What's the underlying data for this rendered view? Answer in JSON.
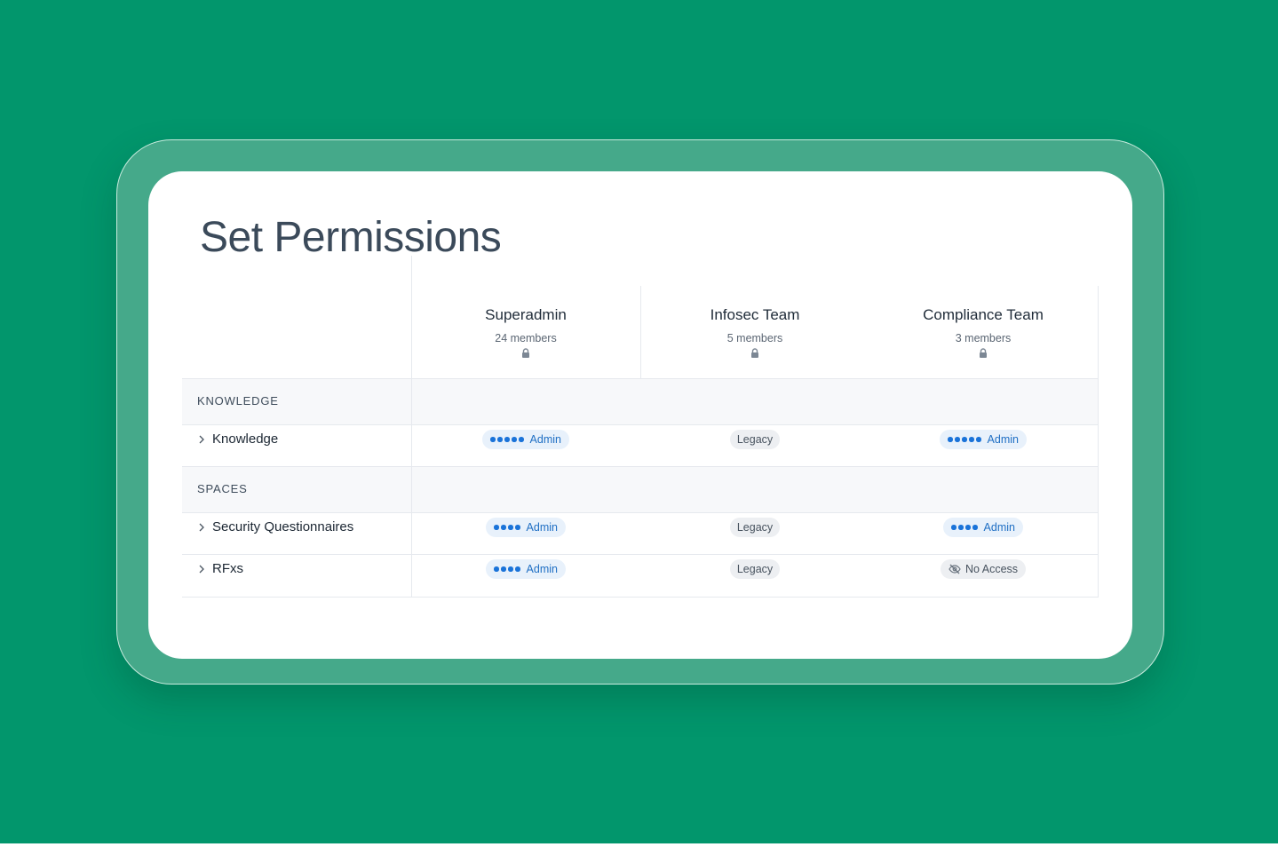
{
  "page": {
    "title": "Set Permissions"
  },
  "columns": [
    {
      "name": "Superadmin",
      "members": "24 members",
      "icon": "lock-icon"
    },
    {
      "name": "Infosec Team",
      "members": "5 members",
      "icon": "lock-icon"
    },
    {
      "name": "Compliance Team",
      "members": "3 members",
      "icon": "lock-icon"
    }
  ],
  "sections": [
    {
      "label": "KNOWLEDGE",
      "rows": [
        {
          "label": "Knowledge",
          "cells": [
            {
              "type": "admin",
              "level": 5,
              "text": "Admin"
            },
            {
              "type": "legacy",
              "text": "Legacy"
            },
            {
              "type": "admin",
              "level": 5,
              "text": "Admin"
            }
          ]
        }
      ]
    },
    {
      "label": "SPACES",
      "rows": [
        {
          "label": "Security Questionnaires",
          "cells": [
            {
              "type": "admin",
              "level": 4,
              "text": "Admin"
            },
            {
              "type": "legacy",
              "text": "Legacy"
            },
            {
              "type": "admin",
              "level": 4,
              "text": "Admin"
            }
          ]
        },
        {
          "label": "RFxs",
          "cells": [
            {
              "type": "admin",
              "level": 4,
              "text": "Admin"
            },
            {
              "type": "legacy",
              "text": "Legacy"
            },
            {
              "type": "noaccess",
              "text": "No Access",
              "icon": "eye-off-icon"
            }
          ]
        }
      ]
    }
  ],
  "colors": {
    "background": "#02966c",
    "accent": "#1a73d9"
  }
}
